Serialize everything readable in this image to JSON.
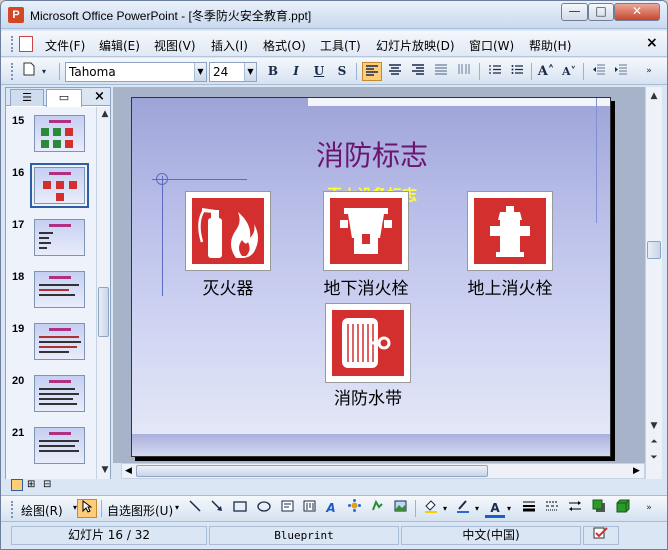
{
  "window": {
    "title": "Microsoft Office PowerPoint - [冬季防火安全教育.ppt]",
    "minimize_label": "—",
    "maximize_label": "□",
    "close_label": "✕"
  },
  "menubar": {
    "items": [
      {
        "label": "文件(F)"
      },
      {
        "label": "编辑(E)"
      },
      {
        "label": "视图(V)"
      },
      {
        "label": "插入(I)"
      },
      {
        "label": "格式(O)"
      },
      {
        "label": "工具(T)"
      },
      {
        "label": "幻灯片放映(D)"
      },
      {
        "label": "窗口(W)"
      },
      {
        "label": "帮助(H)"
      }
    ],
    "doc_close": "×"
  },
  "toolbar": {
    "font_name": "Tahoma",
    "font_size": "24",
    "bold": "B",
    "italic": "I",
    "underline": "U",
    "shadow": "S",
    "align_left_icon": "align-left-icon",
    "align_center_icon": "align-center-icon",
    "align_right_icon": "align-right-icon",
    "increase_font": "A˄",
    "decrease_font": "A˅"
  },
  "left_panel": {
    "tab_outline_icon": "outline-icon",
    "tab_slides_icon": "slides-icon",
    "close": "×",
    "slides": [
      {
        "num": "15"
      },
      {
        "num": "16",
        "selected": true
      },
      {
        "num": "17"
      },
      {
        "num": "18"
      },
      {
        "num": "19"
      },
      {
        "num": "20"
      },
      {
        "num": "21"
      },
      {
        "num": ""
      }
    ]
  },
  "slide": {
    "title": "消防标志",
    "subtitle": "灭火设备标志",
    "signs": [
      {
        "label": "灭火器",
        "icon": "fire-extinguisher-icon"
      },
      {
        "label": "地下消火栓",
        "icon": "underground-hydrant-icon"
      },
      {
        "label": "地上消火栓",
        "icon": "aboveground-hydrant-icon"
      },
      {
        "label": "消防水带",
        "icon": "fire-hose-icon"
      }
    ],
    "accent": "#d42f2f",
    "title_color": "#6b1470",
    "subtitle_color": "#ffff33"
  },
  "drawbar": {
    "draw_label": "绘图(R)",
    "autoshapes_label": "自选图形(U)"
  },
  "statusbar": {
    "slide_info": "幻灯片 16 / 32",
    "template": "Blueprint",
    "language": "中文(中国)"
  }
}
